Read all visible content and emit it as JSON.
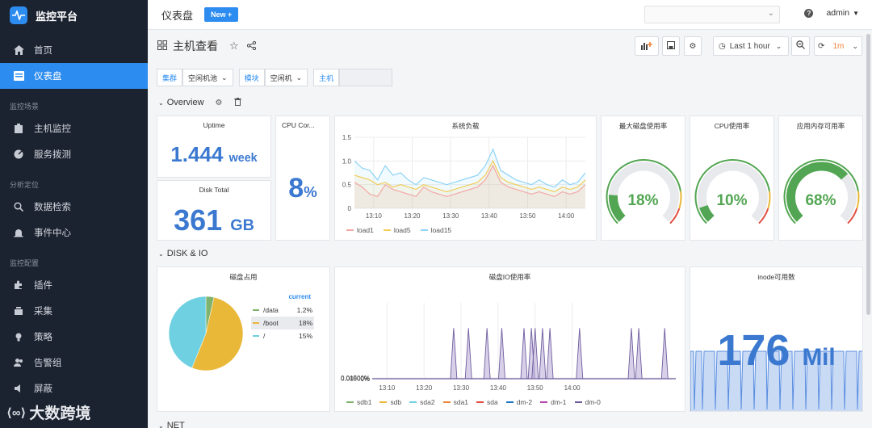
{
  "sidebar": {
    "app_title": "监控平台",
    "items_top": [
      {
        "label": "首页",
        "icon": "home-icon",
        "active": false
      },
      {
        "label": "仪表盘",
        "icon": "dashboard-icon",
        "active": true
      }
    ],
    "sections": [
      {
        "title": "监控场景",
        "items": [
          {
            "label": "主机监控",
            "icon": "host-icon"
          },
          {
            "label": "服务拨测",
            "icon": "probe-icon"
          }
        ]
      },
      {
        "title": "分析定位",
        "items": [
          {
            "label": "数据检索",
            "icon": "search-icon"
          },
          {
            "label": "事件中心",
            "icon": "alarm-icon"
          }
        ]
      },
      {
        "title": "监控配置",
        "items": [
          {
            "label": "插件",
            "icon": "plugin-icon"
          },
          {
            "label": "采集",
            "icon": "collect-icon"
          },
          {
            "label": "策略",
            "icon": "strategy-icon"
          },
          {
            "label": "告警组",
            "icon": "group-icon"
          },
          {
            "label": "屏蔽",
            "icon": "mute-icon"
          }
        ]
      }
    ],
    "bottom_logo": "大数跨境"
  },
  "topbar": {
    "title": "仪表盘",
    "new_button": "New +",
    "user": "admin"
  },
  "dashboard": {
    "title": "主机查看",
    "time_range": "Last 1 hour",
    "refresh_interval": "1m",
    "variables": [
      {
        "label": "集群",
        "value": "空闲机池"
      },
      {
        "label": "模块",
        "value": "空闲机"
      },
      {
        "label": "主机",
        "value": ""
      }
    ]
  },
  "rows": {
    "overview": "Overview",
    "disk_io": "DISK & IO",
    "net": "NET"
  },
  "panels": {
    "uptime": {
      "title": "Uptime",
      "value": "1.444",
      "unit": "week"
    },
    "disk_total": {
      "title": "Disk Total",
      "value": "361",
      "unit": "GB"
    },
    "cpu_cores": {
      "title": "CPU Cor...",
      "value": "8",
      "unit": "%"
    },
    "system_load": {
      "title": "系统负载"
    },
    "gauge_disk": {
      "title": "最大磁盘使用率",
      "value": "18%",
      "pct": 18
    },
    "gauge_cpu": {
      "title": "CPU使用率",
      "value": "10%",
      "pct": 10
    },
    "gauge_mem": {
      "title": "应用内存可用率",
      "value": "68%",
      "pct": 68
    },
    "disk_usage": {
      "title": "磁盘占用",
      "legend_header": "current"
    },
    "disk_io": {
      "title": "磁盘IO使用率"
    },
    "inode": {
      "title": "inode可用数",
      "value": "176",
      "unit": "Mil"
    }
  },
  "chart_data": [
    {
      "type": "line",
      "title": "系统负载",
      "x": [
        "13:05",
        "13:07",
        "13:09",
        "13:11",
        "13:13",
        "13:15",
        "13:17",
        "13:19",
        "13:21",
        "13:23",
        "13:25",
        "13:27",
        "13:29",
        "13:31",
        "13:33",
        "13:35",
        "13:37",
        "13:39",
        "13:41",
        "13:43",
        "13:45",
        "13:47",
        "13:49",
        "13:51",
        "13:53",
        "13:55",
        "13:57",
        "13:59",
        "14:01",
        "14:03",
        "14:05"
      ],
      "xticks": [
        "13:10",
        "13:20",
        "13:30",
        "13:40",
        "13:50",
        "14:00"
      ],
      "ylim": [
        0,
        1.5
      ],
      "yticks": [
        "0",
        "0.5",
        "1.0",
        "1.5"
      ],
      "series": [
        {
          "name": "load1",
          "color": "#f2a6a6",
          "values": [
            0.55,
            0.45,
            0.3,
            0.25,
            0.5,
            0.4,
            0.35,
            0.3,
            0.25,
            0.45,
            0.35,
            0.3,
            0.25,
            0.3,
            0.35,
            0.4,
            0.45,
            0.6,
            0.9,
            0.55,
            0.45,
            0.4,
            0.35,
            0.3,
            0.35,
            0.3,
            0.25,
            0.35,
            0.3,
            0.35,
            0.5
          ]
        },
        {
          "name": "load5",
          "color": "#f2cc5a",
          "values": [
            0.7,
            0.65,
            0.6,
            0.5,
            0.55,
            0.45,
            0.5,
            0.45,
            0.4,
            0.5,
            0.45,
            0.4,
            0.35,
            0.4,
            0.45,
            0.5,
            0.55,
            0.7,
            1.0,
            0.65,
            0.55,
            0.5,
            0.45,
            0.4,
            0.45,
            0.4,
            0.35,
            0.45,
            0.4,
            0.45,
            0.6
          ]
        },
        {
          "name": "load15",
          "color": "#8fd3f5",
          "values": [
            1.0,
            0.85,
            0.8,
            0.6,
            0.9,
            0.7,
            0.75,
            0.6,
            0.5,
            0.65,
            0.6,
            0.55,
            0.5,
            0.55,
            0.6,
            0.65,
            0.7,
            0.9,
            1.25,
            0.8,
            0.7,
            0.6,
            0.55,
            0.5,
            0.6,
            0.5,
            0.45,
            0.6,
            0.5,
            0.55,
            0.75
          ]
        }
      ]
    },
    {
      "type": "pie",
      "title": "磁盘占用",
      "legend_header": "current",
      "slices": [
        {
          "name": "/data",
          "value": 1.2,
          "label": "1.2%",
          "color": "#7eb26d"
        },
        {
          "name": "/boot",
          "value": 18,
          "label": "18%",
          "color": "#eab839"
        },
        {
          "name": "/",
          "value": 15,
          "label": "15%",
          "color": "#6ed0e0"
        }
      ]
    },
    {
      "type": "area",
      "title": "磁盘IO使用率",
      "x": [
        "13:10",
        "13:20",
        "13:30",
        "13:40",
        "13:50",
        "14:00"
      ],
      "ylim": [
        0,
        0.015
      ],
      "yticks": [
        "0%",
        "0.00500%",
        "0.01000%",
        "0.01500%"
      ],
      "spikes_minutes": [
        22,
        26,
        31,
        35,
        41,
        43,
        44,
        46,
        48,
        56,
        70,
        72,
        79
      ],
      "spike_value": 0.01,
      "series": [
        {
          "name": "sdb1",
          "color": "#7eb26d"
        },
        {
          "name": "sdb",
          "color": "#eab839"
        },
        {
          "name": "sda2",
          "color": "#6ed0e0"
        },
        {
          "name": "sda1",
          "color": "#ef843c"
        },
        {
          "name": "sda",
          "color": "#e24d42"
        },
        {
          "name": "dm-2",
          "color": "#1f78c1"
        },
        {
          "name": "dm-1",
          "color": "#ba43a9"
        },
        {
          "name": "dm-0",
          "color": "#705da0"
        }
      ]
    }
  ]
}
